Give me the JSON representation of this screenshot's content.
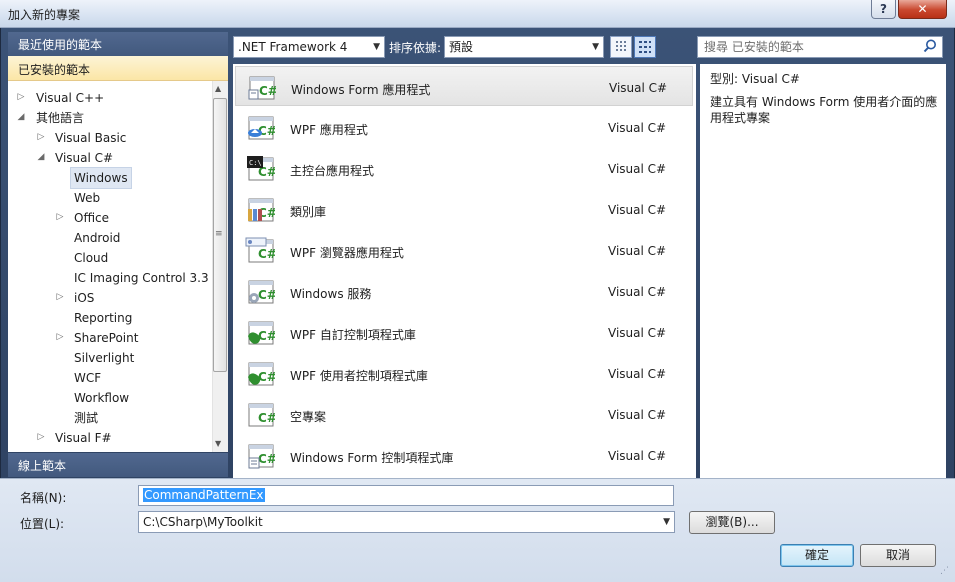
{
  "window": {
    "title": "加入新的專案",
    "help_label": "?",
    "close_label": "✕"
  },
  "left": {
    "recent_label": "最近使用的範本",
    "installed_label": "已安裝的範本",
    "online_label": "線上範本",
    "tree": [
      {
        "label": "Visual C++",
        "arrow": "▷"
      },
      {
        "label": "其他語言",
        "arrow": "◢"
      },
      {
        "label": "Visual Basic",
        "arrow": "▷"
      },
      {
        "label": "Visual C#",
        "arrow": "◢"
      },
      {
        "label": "Windows",
        "arrow": ""
      },
      {
        "label": "Web",
        "arrow": ""
      },
      {
        "label": "Office",
        "arrow": "▷"
      },
      {
        "label": "Android",
        "arrow": ""
      },
      {
        "label": "Cloud",
        "arrow": ""
      },
      {
        "label": "IC Imaging Control 3.3",
        "arrow": ""
      },
      {
        "label": "iOS",
        "arrow": "▷"
      },
      {
        "label": "Reporting",
        "arrow": ""
      },
      {
        "label": "SharePoint",
        "arrow": "▷"
      },
      {
        "label": "Silverlight",
        "arrow": ""
      },
      {
        "label": "WCF",
        "arrow": ""
      },
      {
        "label": "Workflow",
        "arrow": ""
      },
      {
        "label": "測試",
        "arrow": ""
      },
      {
        "label": "Visual F#",
        "arrow": "▷"
      }
    ]
  },
  "toolbar": {
    "framework": ".NET Framework 4",
    "sort_label": "排序依據:",
    "sort_value": "預設",
    "search_placeholder": "搜尋 已安裝的範本"
  },
  "templates": [
    {
      "name": "Windows Form 應用程式",
      "lang": "Visual C#",
      "icon": "winform-app-icon"
    },
    {
      "name": "WPF 應用程式",
      "lang": "Visual C#",
      "icon": "wpf-app-icon"
    },
    {
      "name": "主控台應用程式",
      "lang": "Visual C#",
      "icon": "console-app-icon"
    },
    {
      "name": "類別庫",
      "lang": "Visual C#",
      "icon": "class-library-icon"
    },
    {
      "name": "WPF 瀏覽器應用程式",
      "lang": "Visual C#",
      "icon": "wpf-browser-app-icon"
    },
    {
      "name": "Windows 服務",
      "lang": "Visual C#",
      "icon": "windows-service-icon"
    },
    {
      "name": "WPF 自訂控制項程式庫",
      "lang": "Visual C#",
      "icon": "wpf-custom-control-icon"
    },
    {
      "name": "WPF 使用者控制項程式庫",
      "lang": "Visual C#",
      "icon": "wpf-user-control-icon"
    },
    {
      "name": "空專案",
      "lang": "Visual C#",
      "icon": "empty-project-icon"
    },
    {
      "name": "Windows Form 控制項程式庫",
      "lang": "Visual C#",
      "icon": "winform-control-library-icon"
    }
  ],
  "details": {
    "type_label": "型別:  Visual C#",
    "description": "建立具有 Windows Form 使用者介面的應用程式專案"
  },
  "form": {
    "name_label": "名稱(N):",
    "name_value": "CommandPatternEx",
    "location_label": "位置(L):",
    "location_value": "C:\\CSharp\\MyToolkit",
    "browse_label": "瀏覽(B)...",
    "ok_label": "確定",
    "cancel_label": "取消"
  },
  "colors": {
    "accent_green": "#2f8f2f",
    "selection_yellow": "#fbe6a6",
    "header_blue": "#42597e"
  }
}
